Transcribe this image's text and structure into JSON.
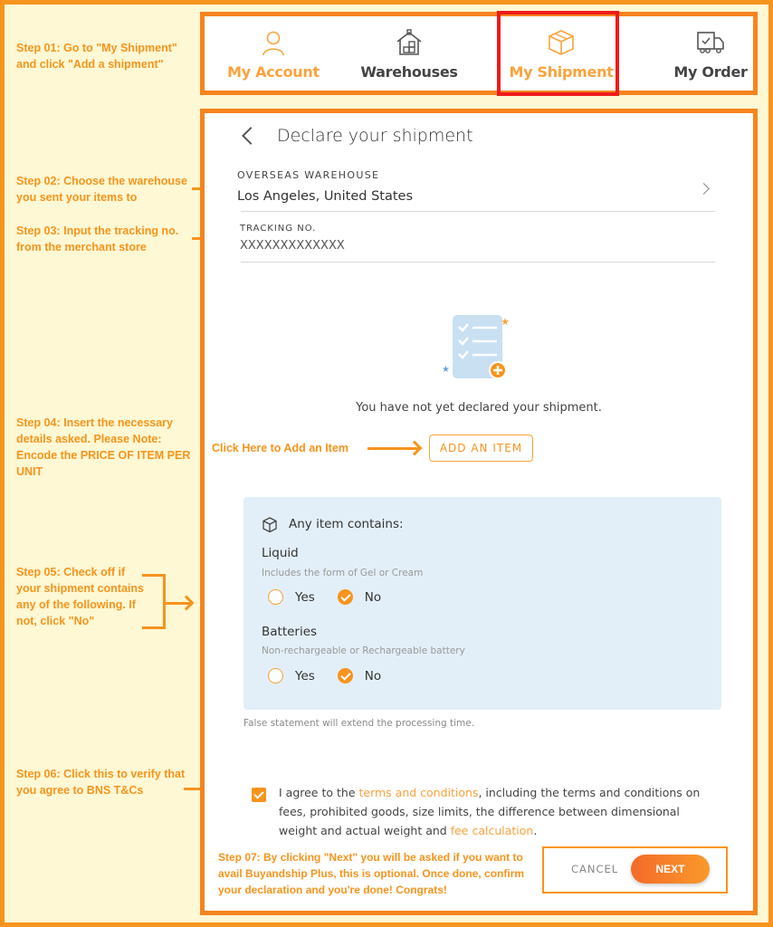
{
  "colors": {
    "accent": "#f7941d",
    "highlight": "#ee1c1c",
    "background": "#fff8d4",
    "info_box": "#e3eff8"
  },
  "annotations": {
    "step01": "Step 01: Go to \"My Shipment\" and click \"Add a shipment\"",
    "step02": "Step 02: Choose the warehouse you sent your items to",
    "step03": "Step 03: Input the tracking no. from the merchant store",
    "step04": "Step 04: Insert the necessary details asked. Please Note: Encode the PRICE OF ITEM PER UNIT",
    "add_item_hint": "Click Here to Add an Item",
    "step05": "Step 05: Check off if your shipment contains any of the following. If not, click \"No\"",
    "step06": "Step 06: Click this to verify that you agree to BNS T&Cs",
    "step07": "Step 07: By clicking \"Next\" you will be asked if you want to avail Buyandship Plus, this is optional. Once done, confirm your declaration and you're done! Congrats!"
  },
  "nav": {
    "items": [
      {
        "label": "My Account",
        "icon": "user-icon",
        "active": false
      },
      {
        "label": "Warehouses",
        "icon": "warehouse-icon",
        "active": false
      },
      {
        "label": "My Shipment",
        "icon": "box-icon",
        "active": true
      },
      {
        "label": "My Order",
        "icon": "delivery-truck-icon",
        "active": false
      }
    ]
  },
  "form": {
    "title": "Declare your shipment",
    "warehouse_label": "OVERSEAS WAREHOUSE",
    "warehouse_value": "Los Angeles, United States",
    "tracking_label": "TRACKING NO.",
    "tracking_value": "XXXXXXXXXXXXX",
    "empty_message": "You have not yet declared your shipment.",
    "add_item_label": "ADD AN ITEM",
    "contains": {
      "title": "Any item contains:",
      "questions": [
        {
          "label": "Liquid",
          "hint": "Includes the form of Gel or Cream",
          "yes": "Yes",
          "no": "No",
          "selected": "No"
        },
        {
          "label": "Batteries",
          "hint": "Non-rechargeable or Rechargeable battery",
          "yes": "Yes",
          "no": "No",
          "selected": "No"
        }
      ]
    },
    "false_note": "False statement will extend the processing time.",
    "agree": {
      "checked": true,
      "prefix": "I agree to the ",
      "link1": "terms and conditions",
      "middle": ", including the terms and conditions on fees, prohibited goods, size limits, the difference between dimensional weight and actual weight and ",
      "link2": "fee calculation",
      "suffix": "."
    },
    "cancel_label": "CANCEL",
    "next_label": "NEXT"
  }
}
